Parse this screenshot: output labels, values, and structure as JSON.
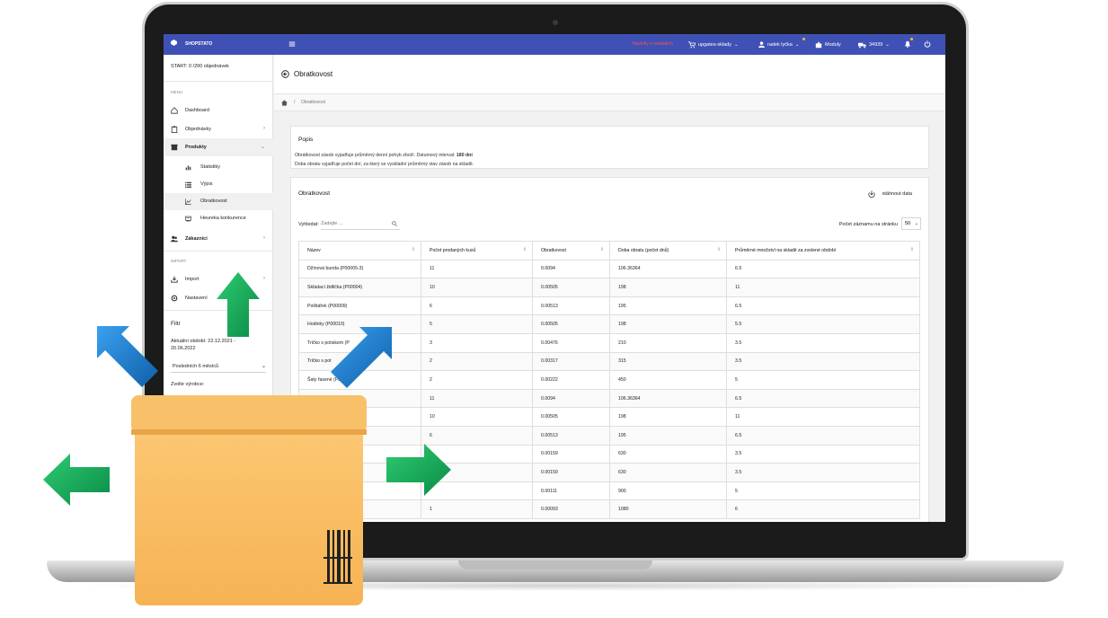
{
  "colors": {
    "primary": "#3f51b5",
    "promo": "#ff5252",
    "arrow": "#1aa15a",
    "arrow_blue": "#1e7fcf",
    "box": "#f9bd63"
  },
  "topbar": {
    "brand": "SHOPSTATO",
    "promo": "Novinky v modulech",
    "store": "upgates-sklady",
    "user": "radek lyčka",
    "modules": "Moduly",
    "orders": "34939"
  },
  "sidebar": {
    "start": "START: 0 /200 objednávek",
    "menu_heading": "MENU",
    "items": [
      {
        "label": "Dashboard",
        "icon": "home-icon"
      },
      {
        "label": "Objednávky",
        "icon": "clipboard-icon"
      },
      {
        "label": "Produkty",
        "icon": "box-icon"
      }
    ],
    "subitems": [
      {
        "label": "Statistiky",
        "icon": "bar-chart-icon"
      },
      {
        "label": "Výpis",
        "icon": "list-icon"
      },
      {
        "label": "Obratkovost",
        "icon": "line-chart-icon"
      },
      {
        "label": "Heureka konkurence",
        "icon": "comparison-icon"
      }
    ],
    "customers": "Zákazníci",
    "import_heading": "IMPORT",
    "import": "Import",
    "settings": "Nastavení",
    "filter": {
      "title": "Filtr",
      "period_label": "Aktuální období: 22.12.2021 - 20.06.2022",
      "period_value": "Posledních 6 měsíců",
      "maker_label": "Zvolte výrobce:"
    }
  },
  "page": {
    "title": "Obratkovost",
    "breadcrumb": "Obratkovost"
  },
  "popis": {
    "title": "Popis",
    "line1_prefix": "Obrátkovost zásob vyjadřuje průměrný denní pohyb zboží. Datumový interval: ",
    "line1_bold": "180 dní",
    "line2": "Doba obratu vyjadřuje počet dní, za který se vyskladní průměrný stav zásob na skladě."
  },
  "table_card": {
    "title": "Obratkovost",
    "download": "stáhnout data",
    "search_label": "Vyhledat:",
    "search_placeholder": "Zadejte ...",
    "page_size_label": "Počet záznamu na stránku",
    "page_size": "50",
    "headers": [
      "Název",
      "Počet prodaných kusů",
      "Obratkovost",
      "Doba obratu (počet dnů)",
      "Průměrné množství na skladě za zvolené období"
    ],
    "rows": [
      [
        "Džínová bunda (P00005-3)",
        "11",
        "0.0094",
        "106.36364",
        "6.5"
      ],
      [
        "Skládací židlička (P00004)",
        "10",
        "0.00505",
        "198",
        "11"
      ],
      [
        "Polštářek (P00009)",
        "6",
        "0.00513",
        "195",
        "6.5"
      ],
      [
        "Hodinky (P00010)",
        "5",
        "0.00505",
        "198",
        "5.5"
      ],
      [
        "Tričko s potiskem (P",
        "3",
        "0.00476",
        "210",
        "3.5"
      ],
      [
        "Tričko s pot",
        "2",
        "0.00317",
        "315",
        "3.5"
      ],
      [
        "Šaty řasené (P0",
        "2",
        "0.00222",
        "450",
        "5"
      ],
      [
        "Džínová bunda (P0000",
        "11",
        "0.0094",
        "106.36364",
        "6.5"
      ],
      [
        "",
        "10",
        "0.00505",
        "198",
        "11"
      ],
      [
        "00",
        "6",
        "0.00513",
        "195",
        "6.5"
      ],
      [
        "00",
        "",
        "0.00159",
        "630",
        "3.5"
      ],
      [
        "003-9)",
        "",
        "0.00159",
        "630",
        "3.5"
      ],
      [
        "",
        "",
        "0.00111",
        "900",
        "5"
      ],
      [
        "",
        "1",
        "0.00093",
        "1080",
        "6"
      ]
    ]
  }
}
